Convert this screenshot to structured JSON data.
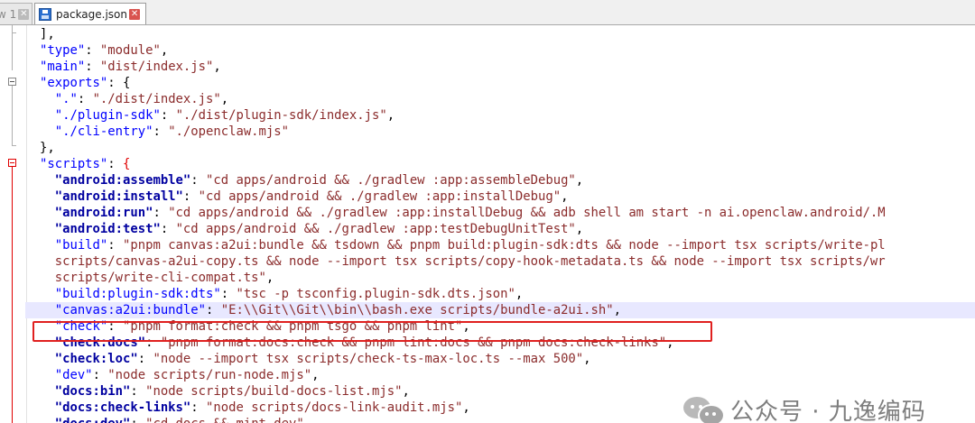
{
  "tabs": {
    "prev_label": "w 1",
    "active_label": "package.json"
  },
  "code_lines": [
    [
      {
        "t": "p",
        "v": "],"
      }
    ],
    [
      {
        "t": "k",
        "v": "\"type\""
      },
      {
        "t": "op",
        "v": ": "
      },
      {
        "t": "s",
        "v": "\"module\""
      },
      {
        "t": "op",
        "v": ","
      }
    ],
    [
      {
        "t": "k",
        "v": "\"main\""
      },
      {
        "t": "op",
        "v": ": "
      },
      {
        "t": "s",
        "v": "\"dist/index.js\""
      },
      {
        "t": "op",
        "v": ","
      }
    ],
    [
      {
        "t": "k",
        "v": "\"exports\""
      },
      {
        "t": "op",
        "v": ": {"
      }
    ],
    [
      {
        "t": "op",
        "v": "  "
      },
      {
        "t": "k",
        "v": "\".\""
      },
      {
        "t": "op",
        "v": ": "
      },
      {
        "t": "s",
        "v": "\"./dist/index.js\""
      },
      {
        "t": "op",
        "v": ","
      }
    ],
    [
      {
        "t": "op",
        "v": "  "
      },
      {
        "t": "k",
        "v": "\"./plugin-sdk\""
      },
      {
        "t": "op",
        "v": ": "
      },
      {
        "t": "s",
        "v": "\"./dist/plugin-sdk/index.js\""
      },
      {
        "t": "op",
        "v": ","
      }
    ],
    [
      {
        "t": "op",
        "v": "  "
      },
      {
        "t": "k",
        "v": "\"./cli-entry\""
      },
      {
        "t": "op",
        "v": ": "
      },
      {
        "t": "s",
        "v": "\"./openclaw.mjs\""
      }
    ],
    [
      {
        "t": "op",
        "v": "},"
      }
    ],
    [
      {
        "t": "k",
        "v": "\"scripts\""
      },
      {
        "t": "op",
        "v": ": "
      },
      {
        "t": "brace-red",
        "v": "{"
      }
    ],
    [
      {
        "t": "op",
        "v": "  "
      },
      {
        "t": "kb",
        "v": "\"android:assemble\""
      },
      {
        "t": "op",
        "v": ": "
      },
      {
        "t": "s",
        "v": "\"cd apps/android && ./gradlew :app:assembleDebug\""
      },
      {
        "t": "op",
        "v": ","
      }
    ],
    [
      {
        "t": "op",
        "v": "  "
      },
      {
        "t": "kb",
        "v": "\"android:install\""
      },
      {
        "t": "op",
        "v": ": "
      },
      {
        "t": "s",
        "v": "\"cd apps/android && ./gradlew :app:installDebug\""
      },
      {
        "t": "op",
        "v": ","
      }
    ],
    [
      {
        "t": "op",
        "v": "  "
      },
      {
        "t": "kb",
        "v": "\"android:run\""
      },
      {
        "t": "op",
        "v": ": "
      },
      {
        "t": "s",
        "v": "\"cd apps/android && ./gradlew :app:installDebug && adb shell am start -n ai.openclaw.android/.M"
      }
    ],
    [
      {
        "t": "op",
        "v": "  "
      },
      {
        "t": "kb",
        "v": "\"android:test\""
      },
      {
        "t": "op",
        "v": ": "
      },
      {
        "t": "s",
        "v": "\"cd apps/android && ./gradlew :app:testDebugUnitTest\""
      },
      {
        "t": "op",
        "v": ","
      }
    ],
    [
      {
        "t": "op",
        "v": "  "
      },
      {
        "t": "k",
        "v": "\"build\""
      },
      {
        "t": "op",
        "v": ": "
      },
      {
        "t": "s",
        "v": "\"pnpm canvas:a2ui:bundle && tsdown && pnpm build:plugin-sdk:dts && node --import tsx scripts/write-pl"
      }
    ],
    [
      {
        "t": "op",
        "v": "  "
      },
      {
        "t": "s",
        "v": "scripts/canvas-a2ui-copy.ts && node --import tsx scripts/copy-hook-metadata.ts && node --import tsx scripts/wr"
      }
    ],
    [
      {
        "t": "op",
        "v": "  "
      },
      {
        "t": "s",
        "v": "scripts/write-cli-compat.ts\""
      },
      {
        "t": "op",
        "v": ","
      }
    ],
    [
      {
        "t": "op",
        "v": "  "
      },
      {
        "t": "k",
        "v": "\"build:plugin-sdk:dts\""
      },
      {
        "t": "op",
        "v": ": "
      },
      {
        "t": "s",
        "v": "\"tsc -p tsconfig.plugin-sdk.dts.json\""
      },
      {
        "t": "op",
        "v": ","
      }
    ],
    [
      {
        "t": "op",
        "v": "  "
      },
      {
        "t": "k",
        "v": "\"canvas:a2ui:bundle\""
      },
      {
        "t": "op",
        "v": ": "
      },
      {
        "t": "s",
        "v": "\"E:\\\\Git\\\\Git\\\\bin\\\\bash.exe scripts/bundle-a2ui.sh\""
      },
      {
        "t": "op",
        "v": ","
      }
    ],
    [
      {
        "t": "op",
        "v": "  "
      },
      {
        "t": "k",
        "v": "\"check\""
      },
      {
        "t": "op",
        "v": ": "
      },
      {
        "t": "s",
        "v": "\"pnpm format:check && pnpm tsgo && pnpm lint\""
      },
      {
        "t": "op",
        "v": ","
      }
    ],
    [
      {
        "t": "op",
        "v": "  "
      },
      {
        "t": "kb",
        "v": "\"check:docs\""
      },
      {
        "t": "op",
        "v": ": "
      },
      {
        "t": "s",
        "v": "\"pnpm format:docs:check && pnpm lint:docs && pnpm docs:check-links\""
      },
      {
        "t": "op",
        "v": ","
      }
    ],
    [
      {
        "t": "op",
        "v": "  "
      },
      {
        "t": "kb",
        "v": "\"check:loc\""
      },
      {
        "t": "op",
        "v": ": "
      },
      {
        "t": "s",
        "v": "\"node --import tsx scripts/check-ts-max-loc.ts --max 500\""
      },
      {
        "t": "op",
        "v": ","
      }
    ],
    [
      {
        "t": "op",
        "v": "  "
      },
      {
        "t": "k",
        "v": "\"dev\""
      },
      {
        "t": "op",
        "v": ": "
      },
      {
        "t": "s",
        "v": "\"node scripts/run-node.mjs\""
      },
      {
        "t": "op",
        "v": ","
      }
    ],
    [
      {
        "t": "op",
        "v": "  "
      },
      {
        "t": "kb",
        "v": "\"docs:bin\""
      },
      {
        "t": "op",
        "v": ": "
      },
      {
        "t": "s",
        "v": "\"node scripts/build-docs-list.mjs\""
      },
      {
        "t": "op",
        "v": ","
      }
    ],
    [
      {
        "t": "op",
        "v": "  "
      },
      {
        "t": "kb",
        "v": "\"docs:check-links\""
      },
      {
        "t": "op",
        "v": ": "
      },
      {
        "t": "s",
        "v": "\"node scripts/docs-link-audit.mjs\""
      },
      {
        "t": "op",
        "v": ","
      }
    ],
    [
      {
        "t": "op",
        "v": "  "
      },
      {
        "t": "kb",
        "v": "\"docs:dev\""
      },
      {
        "t": "op",
        "v": ": "
      },
      {
        "t": "s",
        "v": "\"cd docs && mint dev\""
      },
      {
        "t": "op",
        "v": ","
      }
    ]
  ],
  "watermark": {
    "text": "公众号 · 九逸编码"
  },
  "colors": {
    "key": "#0000ff",
    "key_bold": "#0000a0",
    "string": "#8b2c2c",
    "highlight_border": "#e0201f"
  }
}
